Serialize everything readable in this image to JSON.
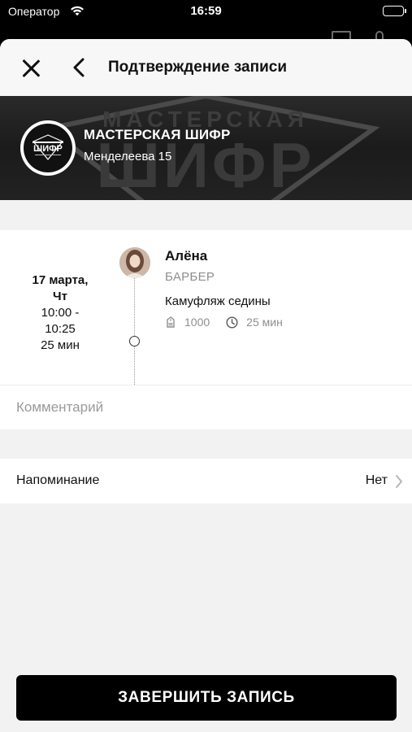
{
  "status_bar": {
    "carrier": "Оператор",
    "time": "16:59"
  },
  "nav": {
    "title": "Подтверждение записи"
  },
  "salon": {
    "name": "МАСТЕРСКАЯ ШИФР",
    "address": "Менделеева 15",
    "logo_text": "ШИФР",
    "banner_watermark_top": "МАСТЕРСКАЯ",
    "banner_watermark_bottom": "ШИФР"
  },
  "booking": {
    "date": "17 марта,",
    "weekday": "Чт",
    "time_start": "10:00 -",
    "time_end": "10:25",
    "duration": "25 мин",
    "master": {
      "name": "Алёна",
      "role": "БАРБЕР"
    },
    "service": {
      "name": "Камуфляж седины",
      "price": "1000",
      "duration": "25 мин"
    },
    "total": "1000"
  },
  "comment": {
    "placeholder": "Комментарий",
    "value": ""
  },
  "reminder": {
    "label": "Напоминание",
    "value": "Нет"
  },
  "actions": {
    "finish_label": "ЗАВЕРШИТЬ ЗАПИСЬ"
  },
  "colors": {
    "accent": "#000000",
    "background": "#f2f2f2",
    "muted_text": "#8e8e8e"
  },
  "icons": [
    "wifi-icon",
    "battery-icon",
    "close-icon",
    "back-chevron-icon",
    "price-tag-icon",
    "clock-icon",
    "chevron-right-icon"
  ]
}
